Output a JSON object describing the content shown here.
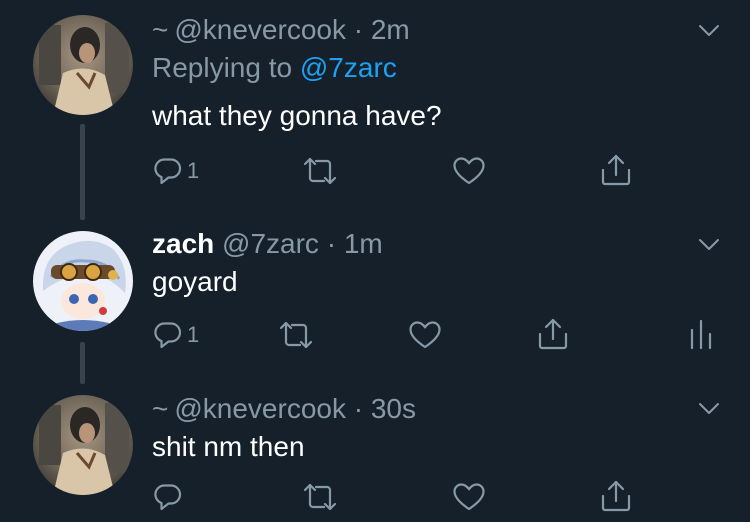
{
  "tweets": [
    {
      "display_name": "~",
      "handle": "@knevercook",
      "time": "· 2m",
      "reply_prefix": "Replying to",
      "reply_to": "@7zarc",
      "text": "what they gonna have?",
      "reply_count": "1"
    },
    {
      "display_name": "zach",
      "handle": "@7zarc",
      "time": "· 1m",
      "text": "goyard",
      "reply_count": "1"
    },
    {
      "display_name": "~",
      "handle": "@knevercook",
      "time": "· 30s",
      "text": "shit nm then",
      "reply_count": ""
    }
  ],
  "icons": {
    "reply": "reply-icon",
    "retweet": "retweet-icon",
    "like": "heart-icon",
    "share": "share-icon",
    "analytics": "analytics-icon",
    "more": "chevron-down-icon"
  },
  "colors": {
    "background": "#15202b",
    "text": "#ffffff",
    "secondary": "#8899a6",
    "link": "#1da1f2",
    "thread_line": "#38444d"
  }
}
